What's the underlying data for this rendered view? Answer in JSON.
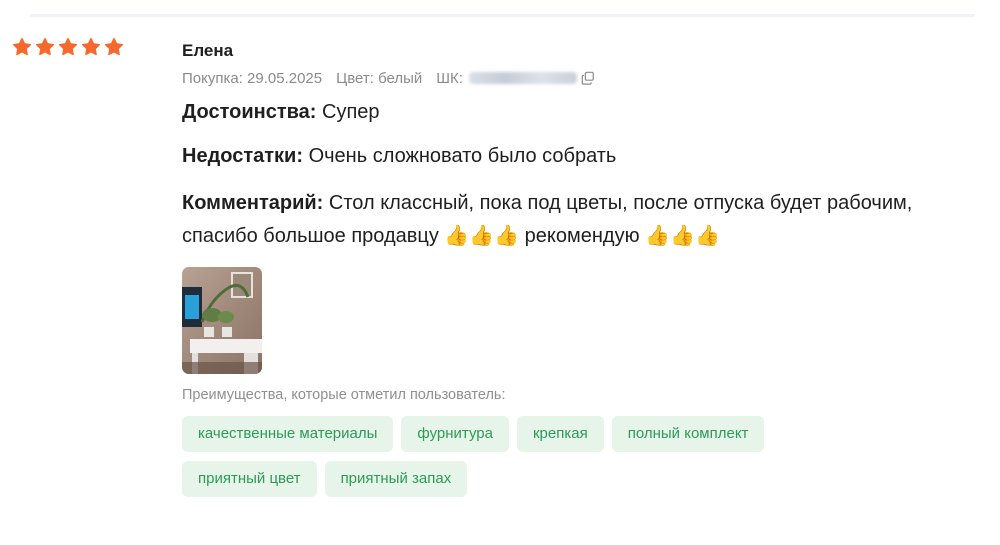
{
  "review": {
    "rating": 5,
    "author": "Елена",
    "purchase_date": "Покупка: 29.05.2025",
    "color": "Цвет: белый",
    "sku_label": "ШК:",
    "pros_label": "Достоинства:",
    "pros": "Супер",
    "cons_label": "Недостатки:",
    "cons": "Очень сложновато было собрать",
    "comment_label": "Комментарий:",
    "comment": "Стол классный, пока под цветы, после отпуска будет рабочим, спасибо большое продавцу 👍👍👍 рекомендую 👍👍👍",
    "advantages_title": "Преимущества, которые отметил пользователь:",
    "advantages": [
      "качественные материалы",
      "фурнитура",
      "крепкая",
      "полный комплект",
      "приятный цвет",
      "приятный запах"
    ]
  },
  "colors": {
    "star": "#f56a2c",
    "chip_bg": "#e6f4ea",
    "chip_text": "#2e9a58",
    "meta_text": "#8b8b8b"
  },
  "icons": {
    "rating": "star-icon",
    "copy": "copy-icon"
  }
}
